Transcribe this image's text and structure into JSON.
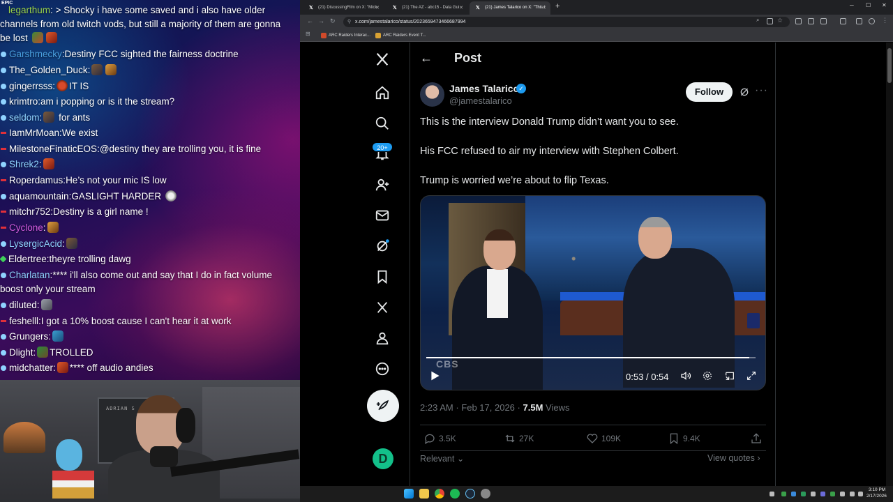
{
  "chat": {
    "messages": [
      {
        "user": "legarthum",
        "text": "> Shocky i have some saved and i also have older channels from old twitch vods, but still a majority of them are gonna be lost",
        "color": "#9ad24a"
      },
      {
        "user": "Garshmecky",
        "text": "Destiny FCC sighted the fairness doctrine",
        "color": "#4aa0e0"
      },
      {
        "user": "The_Golden_Duck",
        "text": "",
        "color": "#ffffff"
      },
      {
        "user": "gingerrsss",
        "text": "IT IS",
        "color": "#ffffff"
      },
      {
        "user": "krimtro",
        "text": "am i popping or is it the stream?",
        "color": "#ffffff"
      },
      {
        "user": "seldom",
        "text": "for ants",
        "color": "#8fd3ff"
      },
      {
        "user": "IamMrMoan",
        "text": "We exist",
        "color": "#ffffff"
      },
      {
        "user": "MilestoneFinaticEOS",
        "text": "@destiny they are trolling you, it is fine",
        "color": "#ffffff"
      },
      {
        "user": "Shrek2",
        "text": "",
        "color": "#8fd3ff"
      },
      {
        "user": "Roperdamus",
        "text": "He’s not your mic IS low",
        "color": "#ffffff"
      },
      {
        "user": "aquamountain",
        "text": "GASLIGHT HARDER",
        "color": "#ffffff"
      },
      {
        "user": "mitchr752",
        "text": "Destiny is a girl name !",
        "color": "#ffffff"
      },
      {
        "user": "Cyclone",
        "text": "",
        "color": "#d35ce0"
      },
      {
        "user": "LysergicAcid",
        "text": "",
        "color": "#8fd3ff"
      },
      {
        "user": "Eldertree",
        "text": "theyre trolling dawg",
        "color": "#ffffff"
      },
      {
        "user": "Charlatan",
        "text": "**** i'll also come out and say that I do in fact volume boost only your stream",
        "color": "#8fd3ff"
      },
      {
        "user": "diluted",
        "text": "",
        "color": "#ffffff"
      },
      {
        "user": "feshelll",
        "text": "I got a 10% boost cause I can't hear it at work",
        "color": "#ffffff"
      },
      {
        "user": "Grungers",
        "text": "",
        "color": "#ffffff"
      },
      {
        "user": "Dlight",
        "text": "TROLLED",
        "color": "#ffffff"
      },
      {
        "user": "midchatter",
        "text": "**** off audio andies",
        "color": "#ffffff"
      }
    ],
    "corner_tag": "EPIC"
  },
  "webcam": {
    "poster_text": "ADRIAN S"
  },
  "browser": {
    "tabs": [
      {
        "title": "(21) DiscussingFilm on X: \"Mick"
      },
      {
        "title": "(21) The AZ - abc15 - Data Gui"
      },
      {
        "title": "(21) James Talarico on X: \"This i"
      }
    ],
    "new_tab": "+",
    "url": "x.com/jamestalarico/status/2023659473466687994",
    "bookmarks": [
      {
        "label": "ARC Raiders Interac..."
      },
      {
        "label": "ARC Raiders Event T..."
      }
    ]
  },
  "post": {
    "header_title": "Post",
    "author_name": "James Talarico",
    "author_handle": "@jamestalarico",
    "follow_label": "Follow",
    "lines": [
      "This is the interview Donald Trump didn’t want you to see.",
      "His FCC refused to air my interview with Stephen Colbert.",
      "Trump is worried we’re about to flip Texas."
    ],
    "video": {
      "current_time": "0:53",
      "separator": "/",
      "duration": "0:54",
      "watermark": "CBS",
      "progress": 0.98
    },
    "time": "2:23 AM",
    "date_separator": "·",
    "date": "Feb 17, 2026",
    "views_count": "7.5M",
    "views_label": "Views",
    "replies": "3.5K",
    "reposts": "27K",
    "likes": "109K",
    "bookmarks": "9.4K",
    "relevant_label": "Relevant",
    "view_quotes_label": "View quotes"
  },
  "nav": {
    "notifications_badge": "20+"
  },
  "taskbar": {
    "time": "3:10 PM",
    "date": "2/17/2026"
  }
}
